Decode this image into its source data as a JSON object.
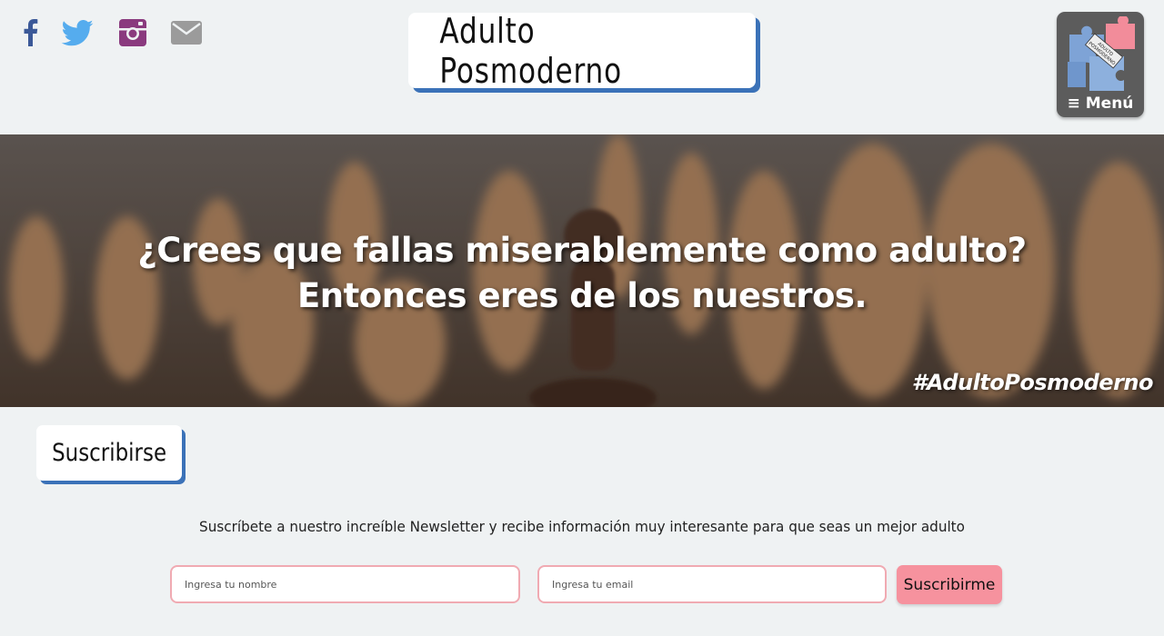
{
  "header": {
    "site_title": "Adulto Posmoderno",
    "menu_label": "≡ Menú",
    "logo_text": "ADULTO POSMODERNO",
    "social": [
      {
        "name": "facebook-icon",
        "color": "#3b5998"
      },
      {
        "name": "twitter-icon",
        "color": "#55acee"
      },
      {
        "name": "instagram-icon",
        "color": "#8a3a7e"
      },
      {
        "name": "mail-icon",
        "color": "#9b9b9b"
      }
    ]
  },
  "hero": {
    "line1": "¿Crees que fallas miserablemente como adulto?",
    "line2": "Entonces eres de los nuestros.",
    "hashtag": "#AdultoPosmoderno"
  },
  "subscribe": {
    "title": "Suscribirse",
    "description": "Suscríbete a nuestro increíble Newsletter y recibe información muy interesante para que seas un mejor adulto",
    "name_placeholder": "Ingresa tu nombre",
    "email_placeholder": "Ingresa tu email",
    "button_label": "Suscribirme"
  },
  "colors": {
    "accent_shadow": "#3b72b8",
    "pink": "#f6929e",
    "background": "#eff2f3"
  }
}
